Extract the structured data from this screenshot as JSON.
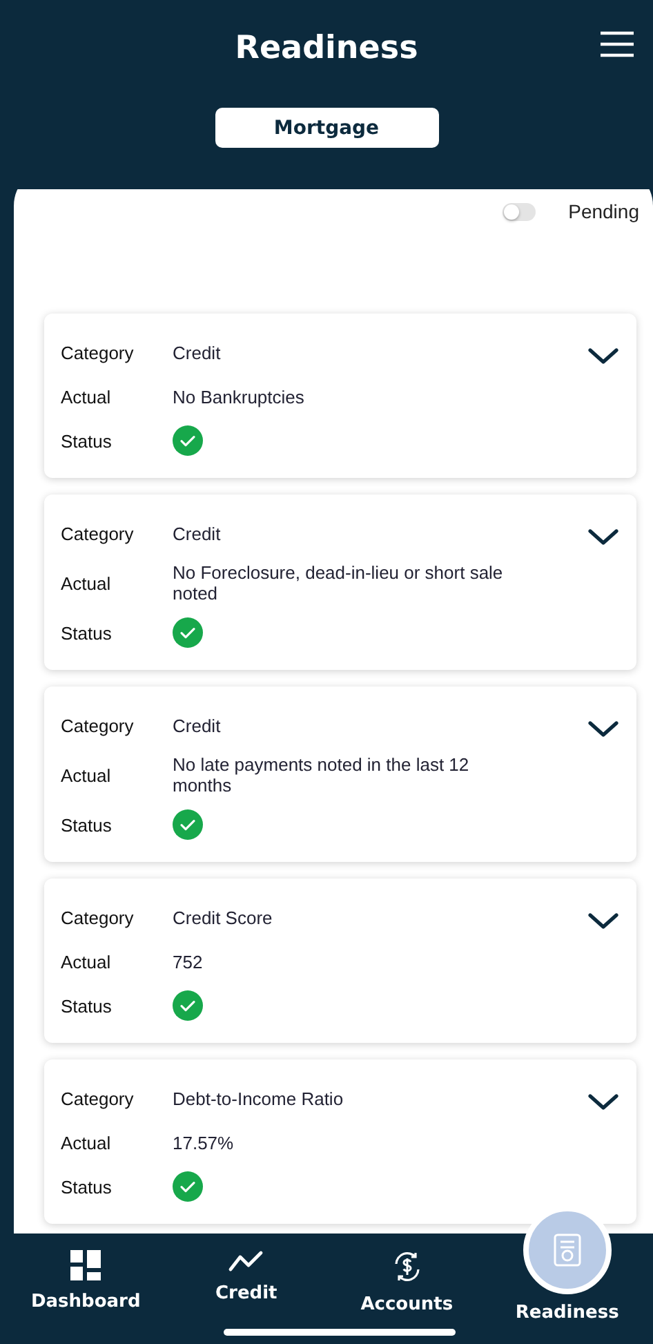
{
  "header": {
    "title": "Readiness",
    "product": "Mortgage"
  },
  "filter": {
    "label": "Pending",
    "on": false
  },
  "items": [
    {
      "category_label": "Category",
      "category": "Credit",
      "actual_label": "Actual",
      "actual": "No Bankruptcies",
      "status_label": "Status",
      "status_ok": true,
      "expanded": false
    },
    {
      "category_label": "Category",
      "category": "Credit",
      "actual_label": "Actual",
      "actual": "No Foreclosure, dead-in-lieu or short sale noted",
      "status_label": "Status",
      "status_ok": true,
      "expanded": false
    },
    {
      "category_label": "Category",
      "category": "Credit",
      "actual_label": "Actual",
      "actual": "No late payments noted in the last 12 months",
      "status_label": "Status",
      "status_ok": true,
      "expanded": false
    },
    {
      "category_label": "Category",
      "category": "Credit Score",
      "actual_label": "Actual",
      "actual": "752",
      "status_label": "Status",
      "status_ok": true,
      "expanded": false
    },
    {
      "category_label": "Category",
      "category": "Debt-to-Income Ratio",
      "actual_label": "Actual",
      "actual": "17.57%",
      "status_label": "Status",
      "status_ok": true,
      "expanded": false
    }
  ],
  "nav": [
    {
      "kind": "dashboard",
      "label": "Dashboard",
      "selected": false
    },
    {
      "kind": "credit",
      "label": "Credit",
      "selected": false
    },
    {
      "kind": "accounts",
      "label": "Accounts",
      "selected": false
    },
    {
      "kind": "readiness",
      "label": "Readiness",
      "selected": true
    }
  ]
}
